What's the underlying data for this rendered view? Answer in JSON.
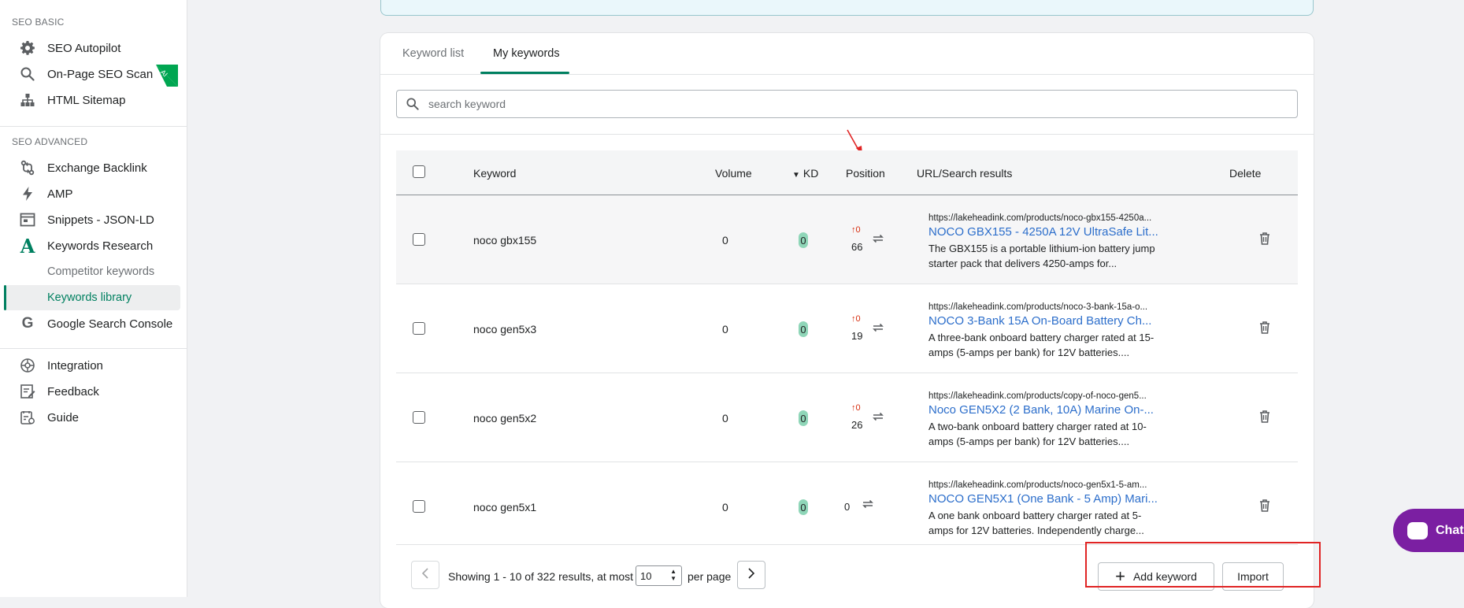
{
  "sidebar": {
    "sections": [
      {
        "title": "SEO BASIC",
        "items": [
          {
            "label": "SEO Autopilot",
            "icon": "gear-icon"
          },
          {
            "label": "On-Page SEO Scan",
            "icon": "search-icon"
          },
          {
            "label": "HTML Sitemap",
            "icon": "sitemap-icon"
          }
        ]
      },
      {
        "title": "SEO ADVANCED",
        "items": [
          {
            "label": "Exchange Backlink",
            "icon": "exchange-icon"
          },
          {
            "label": "AMP",
            "icon": "lightning-icon"
          },
          {
            "label": "Snippets - JSON-LD",
            "icon": "snippet-icon"
          },
          {
            "label": "Keywords Research",
            "icon": "letter-a-icon"
          },
          {
            "label": "Competitor keywords"
          },
          {
            "label": "Keywords library"
          },
          {
            "label": "Google Search Console",
            "icon": "google-icon"
          }
        ]
      },
      {
        "title": "",
        "items": [
          {
            "label": "Integration",
            "icon": "integration-icon"
          },
          {
            "label": "Feedback",
            "icon": "feedback-icon"
          },
          {
            "label": "Guide",
            "icon": "guide-icon"
          }
        ]
      }
    ],
    "ai_badge": "AI"
  },
  "tabs": [
    "Keyword list",
    "My keywords"
  ],
  "active_tab": "My keywords",
  "search": {
    "placeholder": "search keyword"
  },
  "table": {
    "headers": {
      "keyword": "Keyword",
      "volume": "Volume",
      "kd": "KD",
      "position": "Position",
      "url": "URL/Search results",
      "delete": "Delete"
    },
    "rows": [
      {
        "keyword": "noco gbx155",
        "volume": "0",
        "kd": "0",
        "change": "↑0",
        "position": "66",
        "url": "https://lakeheadink.com/products/noco-gbx155-4250a...",
        "title": "NOCO GBX155 - 4250A 12V UltraSafe Lit...",
        "desc": "The GBX155 is a portable lithium-ion battery jump starter pack that delivers 4250-amps for..."
      },
      {
        "keyword": "noco gen5x3",
        "volume": "0",
        "kd": "0",
        "change": "↑0",
        "position": "19",
        "url": "https://lakeheadink.com/products/noco-3-bank-15a-o...",
        "title": "NOCO 3-Bank 15A On-Board Battery Ch...",
        "desc": "A three-bank onboard battery charger rated at 15-amps (5-amps per bank) for 12V batteries...."
      },
      {
        "keyword": "noco gen5x2",
        "volume": "0",
        "kd": "0",
        "change": "↑0",
        "position": "26",
        "url": "https://lakeheadink.com/products/copy-of-noco-gen5...",
        "title": "Noco GEN5X2 (2 Bank, 10A) Marine On-...",
        "desc": "A two-bank onboard battery charger rated at 10-amps (5-amps per bank) for 12V batteries...."
      },
      {
        "keyword": "noco gen5x1",
        "volume": "0",
        "kd": "0",
        "change": "",
        "position": "0",
        "url": "https://lakeheadink.com/products/noco-gen5x1-5-am...",
        "title": "NOCO GEN5X1 (One Bank - 5 Amp) Mari...",
        "desc": "A one bank onboard battery charger rated at 5-amps for 12V batteries. Independently charge..."
      }
    ]
  },
  "pagination": {
    "showing": "Showing 1 - 10 of 322 results, at most",
    "per_page_value": "10",
    "per_page_label": "per page"
  },
  "buttons": {
    "add_keyword": "Add keyword",
    "import": "Import"
  },
  "chat": {
    "label": "Chat"
  },
  "colors": {
    "accent": "#008060",
    "link": "#2c6ecb",
    "kd_badge": "#8fd6b8",
    "annotation_red": "#e02424",
    "chat_purple": "#7b1fa2"
  }
}
